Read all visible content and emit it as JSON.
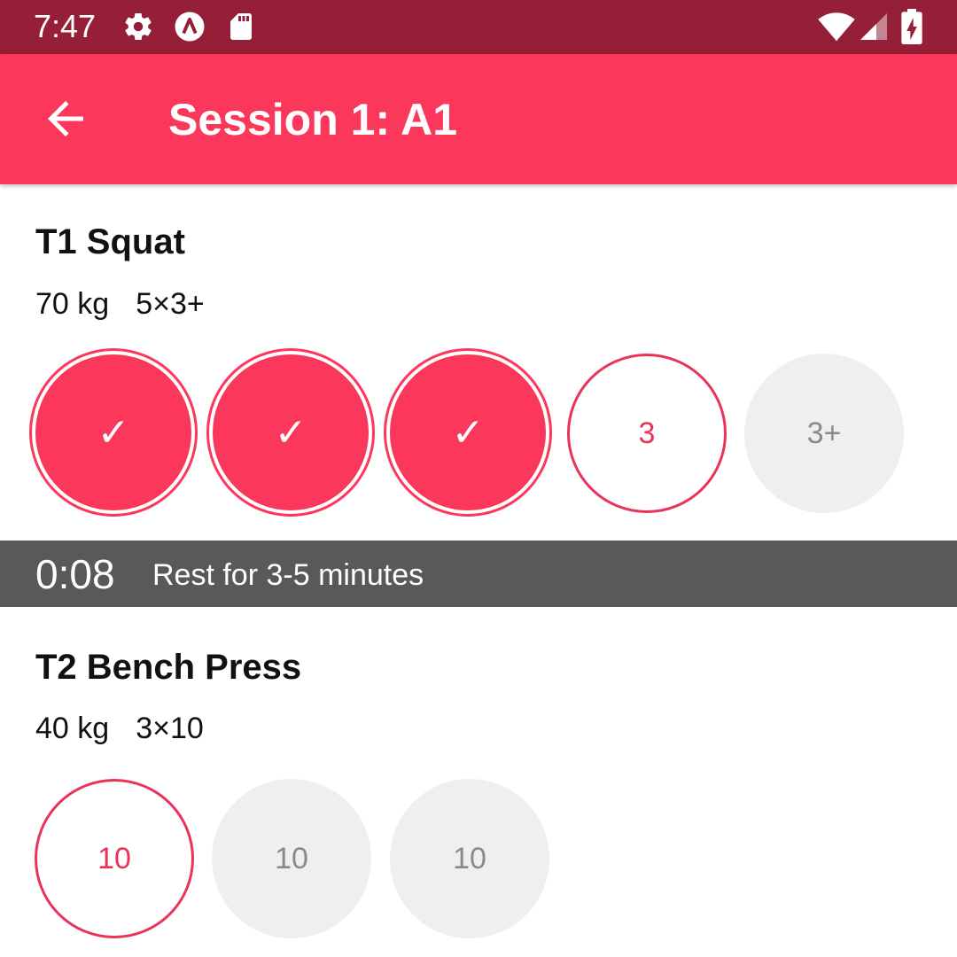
{
  "status_bar": {
    "time": "7:47",
    "icons": [
      "gear-icon",
      "app-badge-icon",
      "sd-card-icon",
      "wifi-icon",
      "cell-signal-icon",
      "battery-charging-icon"
    ]
  },
  "app_bar": {
    "title": "Session 1: A1",
    "back_icon": "arrow-left-icon"
  },
  "colors": {
    "status_bar": "#951f37",
    "primary": "#fc375c",
    "rest_bar": "#595959",
    "pending": "#efefef"
  },
  "exercises": [
    {
      "name": "T1 Squat",
      "weight": "70 kg",
      "scheme": "5×3+",
      "sets": [
        {
          "label": "✓",
          "state": "done"
        },
        {
          "label": "✓",
          "state": "done"
        },
        {
          "label": "✓",
          "state": "done"
        },
        {
          "label": "3",
          "state": "active"
        },
        {
          "label": "3+",
          "state": "pending"
        }
      ]
    },
    {
      "name": "T2 Bench Press",
      "weight": "40 kg",
      "scheme": "3×10",
      "sets": [
        {
          "label": "10",
          "state": "active"
        },
        {
          "label": "10",
          "state": "pending"
        },
        {
          "label": "10",
          "state": "pending"
        }
      ]
    }
  ],
  "rest": {
    "timer": "0:08",
    "message": "Rest for 3-5 minutes"
  }
}
